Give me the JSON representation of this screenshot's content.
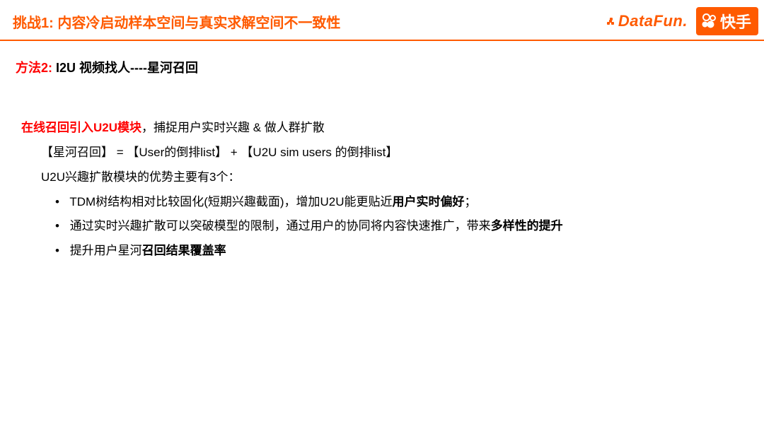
{
  "header": {
    "title": "挑战1: 内容冷启动样本空间与真实求解空间不一致性",
    "logos": {
      "datafun": "DataFun.",
      "kuaishou": "快手"
    }
  },
  "method": {
    "label": "方法2:",
    "text": "  I2U 视频找人----星河召回"
  },
  "body": {
    "intro_red": "在线召回引入U2U模块",
    "intro_rest": "，捕捉用户实时兴趣 & 做人群扩散",
    "equation": "【星河召回】 =  【User的倒排list】  +  【U2U sim users 的倒排list】",
    "advantages_lead": "U2U兴趣扩散模块的优势主要有3个：",
    "bullets": [
      {
        "pre": "TDM树结构相对比较固化(短期兴趣截面)，增加U2U能更贴近",
        "bold": "用户实时偏好",
        "post": "；"
      },
      {
        "pre": "通过实时兴趣扩散可以突破模型的限制，通过用户的协同将内容快速推广，带来",
        "bold": "多样性的提升",
        "post": ""
      },
      {
        "pre": "提升用户星河",
        "bold": "召回结果覆盖率",
        "post": ""
      }
    ]
  }
}
